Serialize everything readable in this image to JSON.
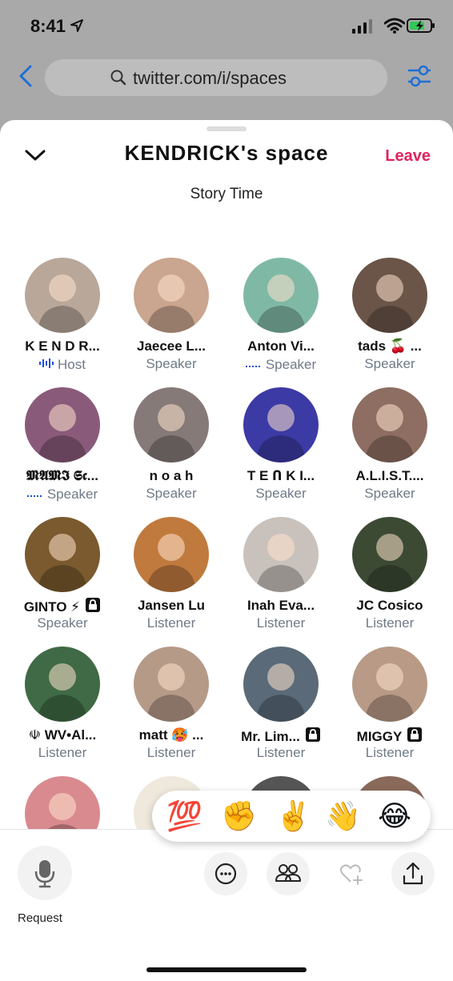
{
  "status_bar": {
    "time": "8:41"
  },
  "browser": {
    "url": "twitter.com/i/spaces"
  },
  "space": {
    "title": "KENDRICK's space",
    "leave_label": "Leave",
    "subtitle": "Story Time"
  },
  "participants": [
    {
      "name": "K E N D R...",
      "role": "Host",
      "speaking": true,
      "locked": false,
      "color": "#b9a79a"
    },
    {
      "name": "Jaecee L...",
      "role": "Speaker",
      "speaking": false,
      "locked": false,
      "color": "#caa58f"
    },
    {
      "name": "Anton Vi...",
      "role": "Speaker",
      "speaking": true,
      "locked": false,
      "color": "#7fb9a6"
    },
    {
      "name": "tads 🍒 ...",
      "role": "Speaker",
      "speaking": false,
      "locked": false,
      "color": "#6b5548"
    },
    {
      "name": "𝕸𝕬𝕸𝕴 𝕾𝖈...",
      "role": "Speaker",
      "speaking": true,
      "locked": false,
      "color": "#8a5a7a"
    },
    {
      "name": "n o a h",
      "role": "Speaker",
      "speaking": false,
      "locked": false,
      "color": "#857a78"
    },
    {
      "name": "T E Ո K I...",
      "role": "Speaker",
      "speaking": false,
      "locked": false,
      "color": "#3c3aa5"
    },
    {
      "name": "A.L.I.S.T....",
      "role": "Speaker",
      "speaking": false,
      "locked": false,
      "color": "#8e6e62"
    },
    {
      "name": "GINTO ⚡",
      "role": "Speaker",
      "speaking": false,
      "locked": true,
      "color": "#7a5a2e"
    },
    {
      "name": "Jansen Lu",
      "role": "Listener",
      "speaking": false,
      "locked": false,
      "color": "#c07a3e"
    },
    {
      "name": "Inah Eva...",
      "role": "Listener",
      "speaking": false,
      "locked": false,
      "color": "#c9c2bc"
    },
    {
      "name": "JC Cosico",
      "role": "Listener",
      "speaking": false,
      "locked": false,
      "color": "#3c4a34"
    },
    {
      "name": "☫ WV•Al...",
      "role": "Listener",
      "speaking": false,
      "locked": false,
      "color": "#3f6a45"
    },
    {
      "name": "matt 🥵 ...",
      "role": "Listener",
      "speaking": false,
      "locked": false,
      "color": "#b69a88"
    },
    {
      "name": "Mr. Lim...",
      "role": "Listener",
      "speaking": false,
      "locked": true,
      "color": "#5a6a78"
    },
    {
      "name": "MIGGY",
      "role": "Listener",
      "speaking": false,
      "locked": true,
      "color": "#b89a86"
    }
  ],
  "partial_row_colors": [
    "#d98a8f",
    "#efe8dc",
    "#555555",
    "#8a6a5a"
  ],
  "reactions": [
    "💯",
    "✊",
    "✌️",
    "👋",
    "😂"
  ],
  "controls": {
    "request_label": "Request",
    "icons": [
      "microphone-icon",
      "more-icon",
      "people-icon",
      "heart-plus-icon",
      "share-icon"
    ]
  },
  "accent_color": "#e0245e",
  "speaking_color": "#1d4ed8"
}
